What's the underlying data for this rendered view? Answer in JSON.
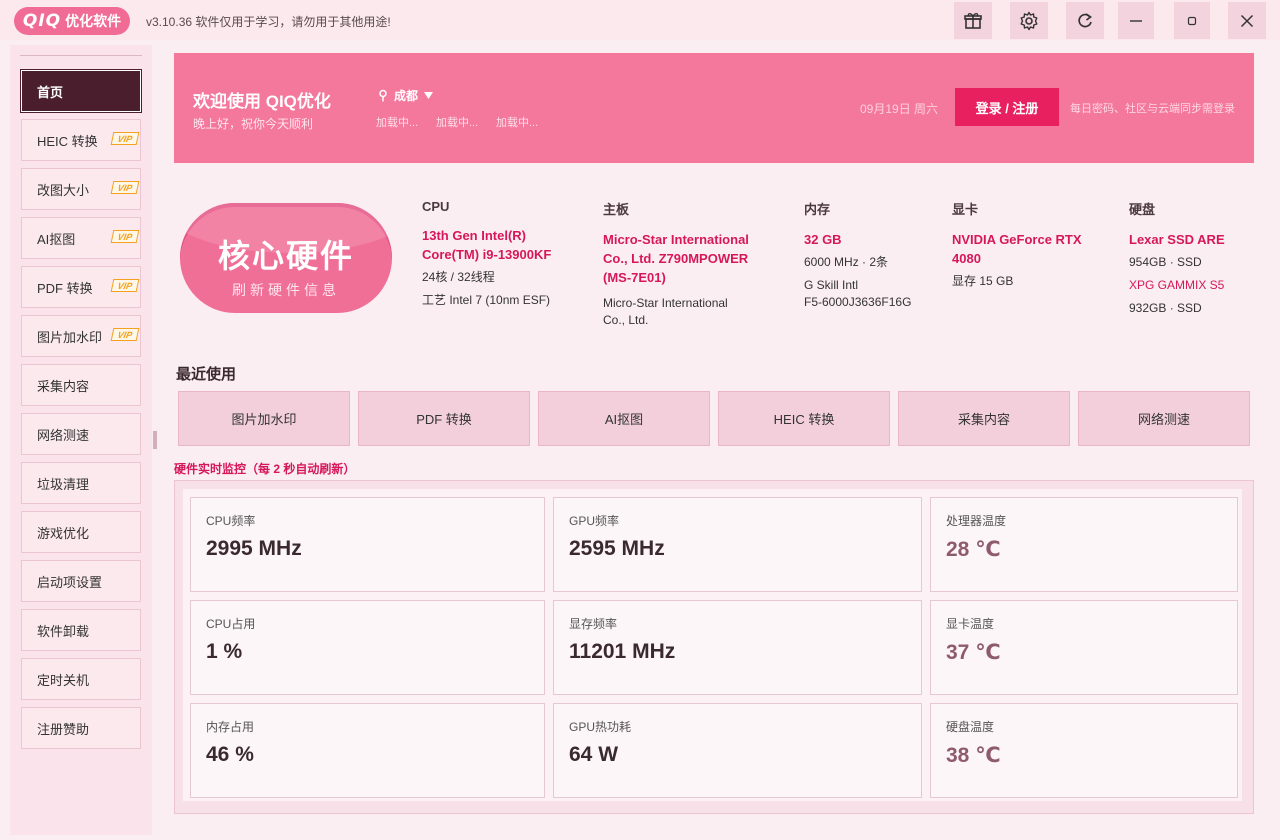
{
  "app": {
    "logo_brand": "QIQ",
    "logo_text": "优化软件",
    "version_notice": "v3.10.36 软件仅用于学习，请勿用于其他用途!"
  },
  "titlebar": {
    "icons": [
      "gift-box-icon",
      "gear-icon",
      "refresh-icon",
      "minimize-icon",
      "maximize-icon",
      "close-icon"
    ]
  },
  "sidebar": {
    "items": [
      {
        "label": "首页",
        "vip": false,
        "active": true
      },
      {
        "label": "HEIC 转换",
        "vip": true
      },
      {
        "label": "改图大小",
        "vip": true
      },
      {
        "label": "AI抠图",
        "vip": true
      },
      {
        "label": "PDF 转换",
        "vip": true
      },
      {
        "label": "图片加水印",
        "vip": true
      },
      {
        "label": "采集内容",
        "vip": false
      },
      {
        "label": "网络测速",
        "vip": false
      },
      {
        "label": "垃圾清理",
        "vip": false
      },
      {
        "label": "游戏优化",
        "vip": false
      },
      {
        "label": "启动项设置",
        "vip": false
      },
      {
        "label": "软件卸载",
        "vip": false
      },
      {
        "label": "定时关机",
        "vip": false
      },
      {
        "label": "注册赞助",
        "vip": false
      }
    ],
    "vip_label": "VIP"
  },
  "banner": {
    "title": "欢迎使用 QIQ优化",
    "subtitle": "晚上好，祝你今天顺利",
    "city": "成都",
    "loading": [
      "加载中...",
      "加载中...",
      "加载中..."
    ],
    "date": "09月19日 周六",
    "login_label": "登录 / 注册",
    "login_note": "每日密码、社区与云端同步需登录"
  },
  "core": {
    "title": "核心硬件",
    "subtitle": "刷新硬件信息"
  },
  "hardware": {
    "cpu": {
      "head": "CPU",
      "main1": "13th Gen Intel(R)",
      "main2": "Core(TM) i9-13900KF",
      "d1": "24核 / 32线程",
      "d2": "工艺 Intel 7 (10nm ESF)"
    },
    "board": {
      "head": "主板",
      "main1": "Micro-Star International",
      "main2": "Co., Ltd. Z790MPOWER",
      "main3": "(MS-7E01)",
      "d1": "Micro-Star International",
      "d2": "Co., Ltd."
    },
    "memory": {
      "head": "内存",
      "main1": "32 GB",
      "d1": "6000 MHz · 2条",
      "d2": "G Skill Intl",
      "d3": "F5-6000J3636F16G"
    },
    "gpu": {
      "head": "显卡",
      "main1": "NVIDIA GeForce RTX",
      "main2": "4080",
      "d1": "显存 15 GB"
    },
    "disk": {
      "head": "硬盘",
      "main1": "Lexar SSD ARE",
      "d1": "954GB · SSD",
      "d2": "XPG GAMMIX S5",
      "d3": "932GB · SSD"
    }
  },
  "recent": {
    "title": "最近使用",
    "items": [
      "图片加水印",
      "PDF 转换",
      "AI抠图",
      "HEIC 转换",
      "采集内容",
      "网络测速"
    ]
  },
  "monitor": {
    "title": "硬件实时监控（每 2 秒自动刷新）",
    "cards": [
      {
        "label": "CPU频率",
        "value": "2995 MHz"
      },
      {
        "label": "GPU频率",
        "value": "2595 MHz"
      },
      {
        "label": "处理器温度",
        "value": "28 ℃"
      },
      {
        "label": "CPU占用",
        "value": "1 %"
      },
      {
        "label": "显存频率",
        "value": "11201 MHz"
      },
      {
        "label": "显卡温度",
        "value": "37 ℃"
      },
      {
        "label": "内存占用",
        "value": "46 %"
      },
      {
        "label": "GPU热功耗",
        "value": "64 W"
      },
      {
        "label": "硬盘温度",
        "value": "38 ℃"
      }
    ]
  }
}
